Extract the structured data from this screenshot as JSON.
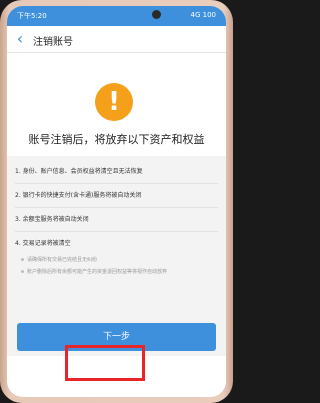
{
  "status": {
    "time": "下午5:20",
    "right_text": "4G 100"
  },
  "header": {
    "back_icon": "chevron-left-icon",
    "title": "注销账号"
  },
  "warning": {
    "icon": "exclamation-icon",
    "symbol": "!"
  },
  "heading": "账号注销后，将放弃以下资产和权益",
  "items": [
    "1. 身份、账户信息、会员权益将清空且无法恢复",
    "2. 银行卡的快捷支付(含卡通)服务将被自动关闭",
    "3. 余额宝服务将被自动关闭",
    "4. 交易记录将被清空"
  ],
  "notes": [
    "请确保所有交易已完结且无纠纷",
    "账户删除后所有余额可能产生的资金退回权益等将视作自动放弃"
  ],
  "next_button": "下一步",
  "colors": {
    "accent": "#3e8fdc",
    "warning": "#f5a01a",
    "highlight": "#e8262a"
  }
}
